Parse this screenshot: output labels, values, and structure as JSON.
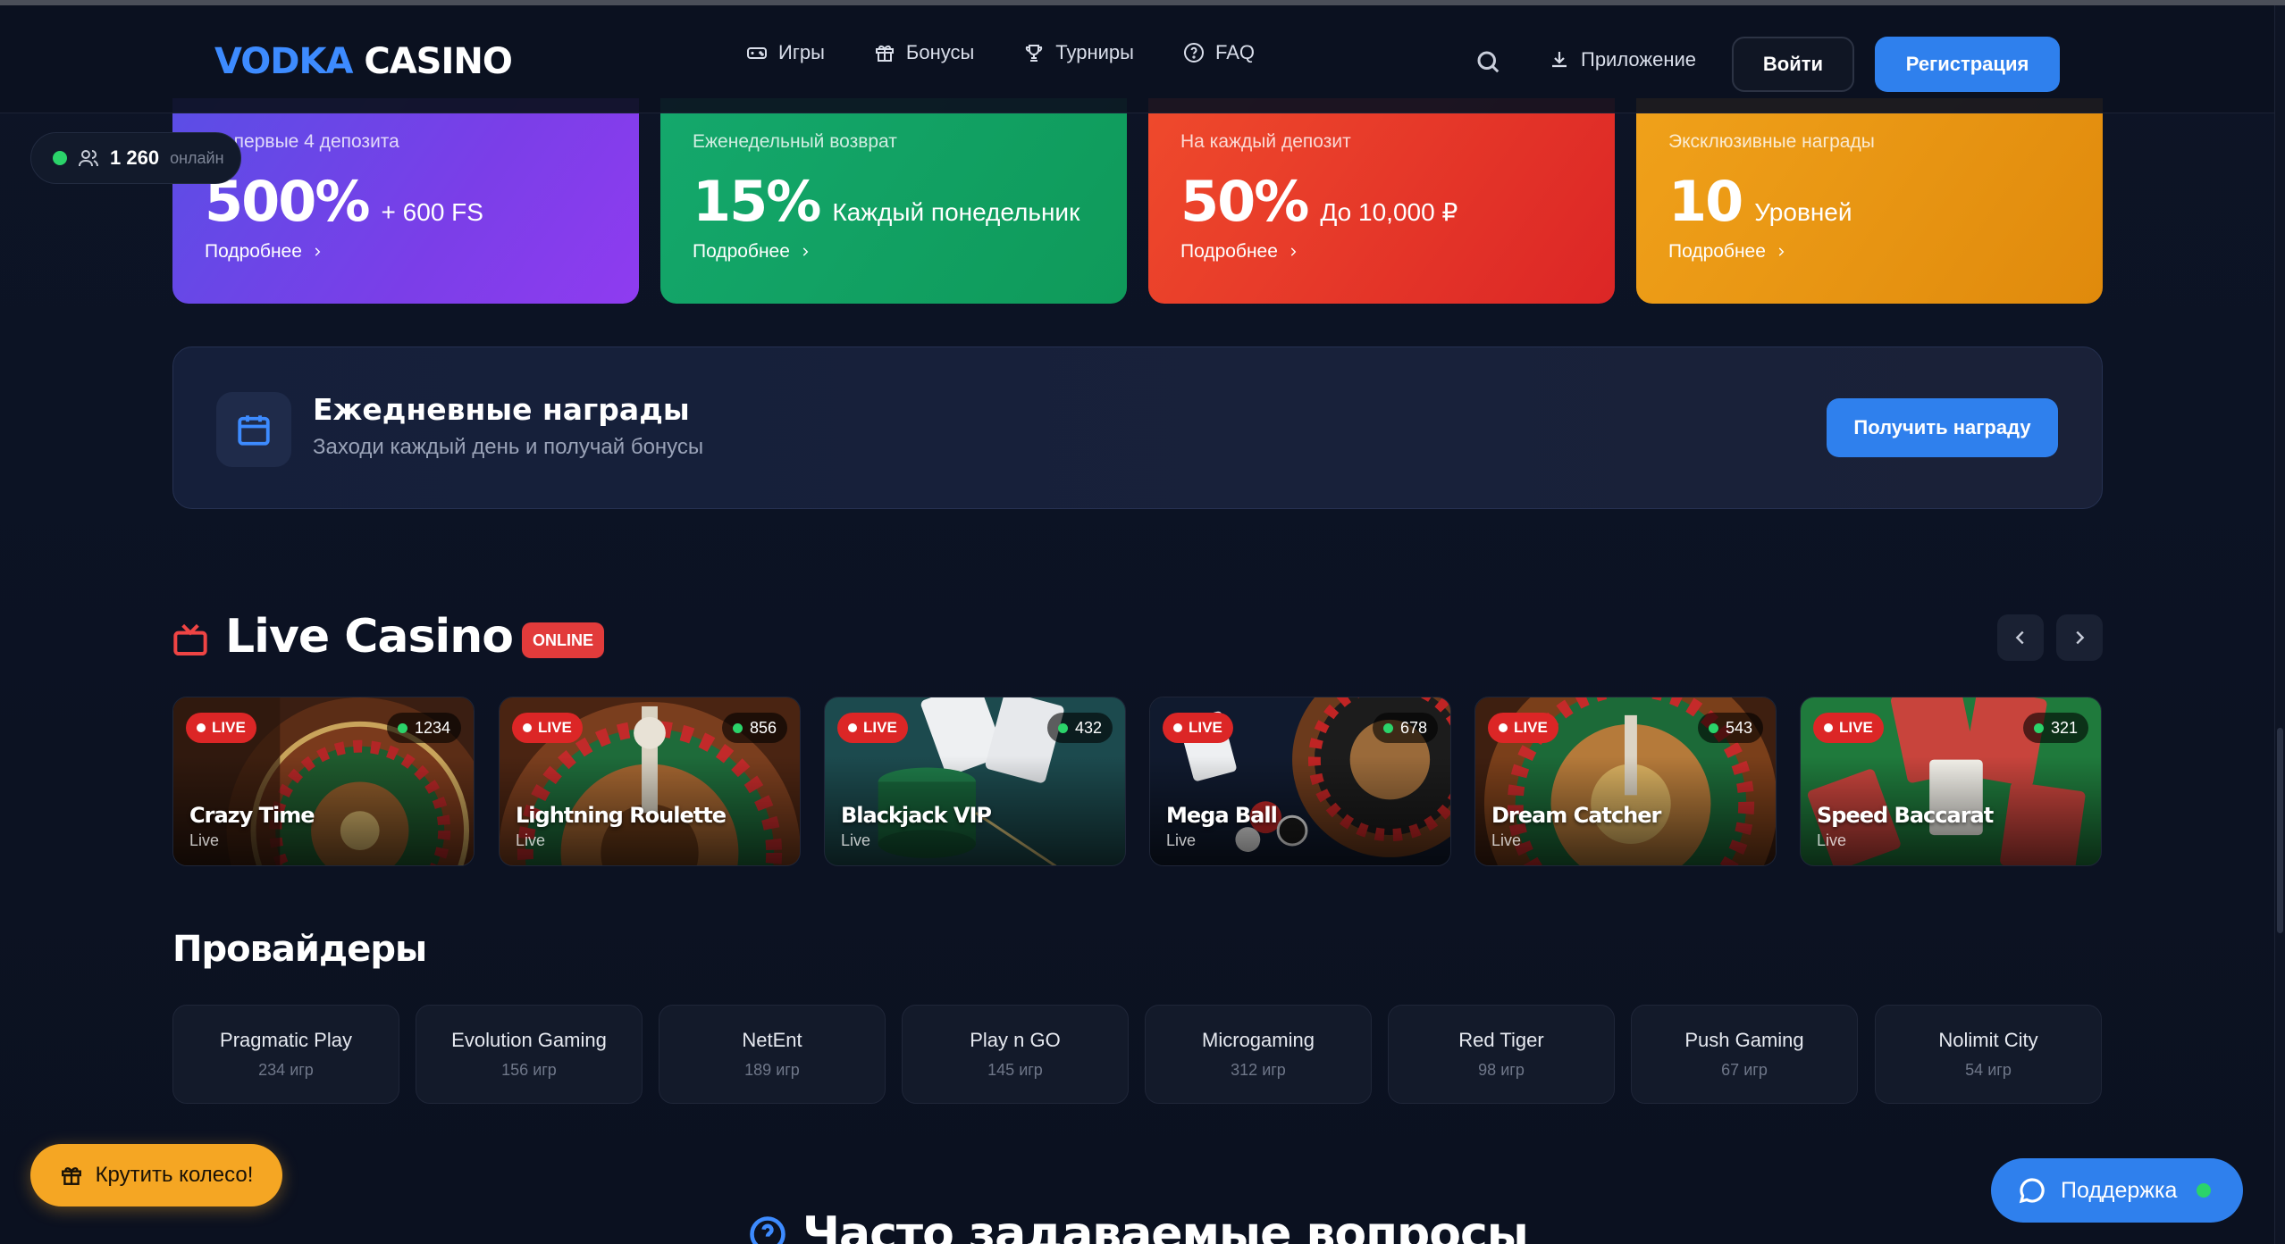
{
  "header": {
    "logo_part1": "V",
    "logo_part2": "ODKA",
    "logo_part3": " CASINO",
    "nav": [
      {
        "label": "Игры",
        "icon": "gamepad-icon"
      },
      {
        "label": "Бонусы",
        "icon": "gift-icon"
      },
      {
        "label": "Турниры",
        "icon": "trophy-icon"
      },
      {
        "label": "FAQ",
        "icon": "help-circle-icon"
      }
    ],
    "app_label": "Приложение",
    "login_label": "Войти",
    "register_label": "Регистрация"
  },
  "online": {
    "count": "1 260",
    "label": "онлайн"
  },
  "promos": [
    {
      "sub": "На первые 4 депозита",
      "value": "500%",
      "extra": "+ 600 FS",
      "more": "Подробнее",
      "color": "#6b46e8"
    },
    {
      "sub": "Еженедельный возврат",
      "value": "15%",
      "extra": "Каждый понедельник",
      "more": "Подробнее",
      "color": "#14a86c"
    },
    {
      "sub": "На каждый депозит",
      "value": "50%",
      "extra": "До 10,000 ₽",
      "more": "Подробнее",
      "color": "#e5382a"
    },
    {
      "sub": "Эксклюзивные награды",
      "value": "10",
      "extra": "Уровней",
      "more": "Подробнее",
      "color": "#ea9714"
    }
  ],
  "daily": {
    "title": "Ежедневные награды",
    "subtitle": "Заходи каждый день и получай бонусы",
    "button": "Получить награду"
  },
  "live_casino": {
    "title": "Live Casino",
    "badge": "ONLINE",
    "games": [
      {
        "name": "Crazy Time",
        "category": "Live",
        "live": "LIVE",
        "viewers": "1234"
      },
      {
        "name": "Lightning Roulette",
        "category": "Live",
        "live": "LIVE",
        "viewers": "856"
      },
      {
        "name": "Blackjack VIP",
        "category": "Live",
        "live": "LIVE",
        "viewers": "432"
      },
      {
        "name": "Mega Ball",
        "category": "Live",
        "live": "LIVE",
        "viewers": "678"
      },
      {
        "name": "Dream Catcher",
        "category": "Live",
        "live": "LIVE",
        "viewers": "543"
      },
      {
        "name": "Speed Baccarat",
        "category": "Live",
        "live": "LIVE",
        "viewers": "321"
      }
    ]
  },
  "providers": {
    "title": "Провайдеры",
    "items": [
      {
        "name": "Pragmatic Play",
        "count": "234 игр"
      },
      {
        "name": "Evolution Gaming",
        "count": "156 игр"
      },
      {
        "name": "NetEnt",
        "count": "189 игр"
      },
      {
        "name": "Play n GO",
        "count": "145 игр"
      },
      {
        "name": "Microgaming",
        "count": "312 игр"
      },
      {
        "name": "Red Tiger",
        "count": "98 игр"
      },
      {
        "name": "Push Gaming",
        "count": "67 игр"
      },
      {
        "name": "Nolimit City",
        "count": "54 игр"
      }
    ]
  },
  "floating": {
    "wheel_label": "Крутить колесо!",
    "support_label": "Поддержка"
  },
  "faq": {
    "title": "Часто задаваемые вопросы"
  },
  "colors": {
    "accent": "#2f80ed",
    "live": "#dc2626",
    "online": "#2bd36a",
    "wheel": "#f5a623"
  }
}
